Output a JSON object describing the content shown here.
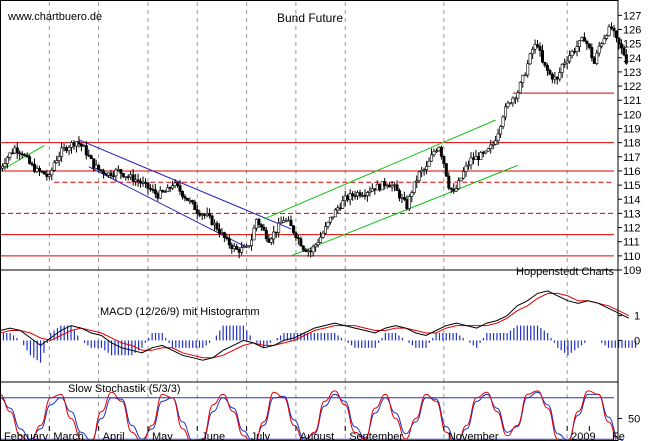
{
  "watermark": "www.chartbuero.de",
  "credit": "Hoppenstedt Charts",
  "colors": {
    "background": "#ffffff",
    "grid": "#9a9a9a",
    "price": "#000000",
    "support": "#e00000",
    "downtrend": "#2020c0",
    "uptrend": "#10c010",
    "macd": "#000000",
    "signal": "#e00000",
    "histogram": "#2030c8",
    "stoch_k": "#e00000",
    "stoch_d": "#2030c8",
    "band": "#2030c8"
  },
  "chart_data": [
    {
      "type": "candlestick",
      "title": "Bund Future",
      "y_ticks": [
        109,
        110,
        111,
        112,
        113,
        114,
        115,
        116,
        117,
        118,
        119,
        120,
        121,
        122,
        123,
        124,
        125,
        126,
        127
      ],
      "ylim": [
        109,
        127.8
      ],
      "x_range_months": [
        0,
        12.45
      ],
      "x_month_labels": [
        {
          "label": "February",
          "m": 0.5
        },
        {
          "label": "March",
          "m": 1.5
        },
        {
          "label": "April",
          "m": 2.5
        },
        {
          "label": "May",
          "m": 3.5
        },
        {
          "label": "June",
          "m": 4.5
        },
        {
          "label": "July",
          "m": 5.5
        },
        {
          "label": "August",
          "m": 6.5
        },
        {
          "label": "September",
          "m": 7.5
        },
        {
          "label": "November",
          "m": 9.5
        },
        {
          "label": "2009",
          "m": 12.0
        },
        {
          "label": "Fe",
          "m": 12.45
        }
      ],
      "price_path": [
        [
          0,
          116.2
        ],
        [
          0.15,
          117.0
        ],
        [
          0.3,
          117.6
        ],
        [
          0.45,
          117.3
        ],
        [
          0.6,
          116.5
        ],
        [
          0.75,
          116.0
        ],
        [
          0.9,
          115.8
        ],
        [
          1.0,
          115.5
        ],
        [
          1.1,
          116.6
        ],
        [
          1.25,
          117.4
        ],
        [
          1.4,
          117.8
        ],
        [
          1.55,
          118.1
        ],
        [
          1.7,
          117.6
        ],
        [
          1.8,
          117.0
        ],
        [
          1.9,
          116.4
        ],
        [
          2.0,
          116.1
        ],
        [
          2.2,
          115.8
        ],
        [
          2.4,
          116.0
        ],
        [
          2.6,
          115.6
        ],
        [
          2.8,
          115.3
        ],
        [
          3.0,
          114.8
        ],
        [
          3.2,
          114.3
        ],
        [
          3.4,
          114.6
        ],
        [
          3.5,
          115.1
        ],
        [
          3.6,
          114.8
        ],
        [
          3.8,
          114.0
        ],
        [
          4.0,
          113.2
        ],
        [
          4.2,
          112.8
        ],
        [
          4.4,
          112.0
        ],
        [
          4.6,
          111.0
        ],
        [
          4.8,
          110.4
        ],
        [
          5.0,
          110.5
        ],
        [
          5.1,
          111.2
        ],
        [
          5.2,
          112.6
        ],
        [
          5.3,
          112.0
        ],
        [
          5.45,
          111.2
        ],
        [
          5.6,
          111.8
        ],
        [
          5.75,
          112.6
        ],
        [
          5.85,
          112.3
        ],
        [
          6.0,
          111.5
        ],
        [
          6.15,
          110.6
        ],
        [
          6.3,
          110.3
        ],
        [
          6.4,
          110.8
        ],
        [
          6.55,
          111.6
        ],
        [
          6.7,
          112.6
        ],
        [
          6.85,
          113.4
        ],
        [
          7.0,
          114.0
        ],
        [
          7.2,
          114.4
        ],
        [
          7.4,
          114.5
        ],
        [
          7.55,
          114.8
        ],
        [
          7.7,
          114.9
        ],
        [
          7.85,
          115.2
        ],
        [
          8.0,
          114.8
        ],
        [
          8.15,
          114.0
        ],
        [
          8.25,
          113.5
        ],
        [
          8.35,
          114.6
        ],
        [
          8.5,
          115.8
        ],
        [
          8.65,
          116.2
        ],
        [
          8.8,
          117.4
        ],
        [
          8.9,
          117.8
        ],
        [
          9.0,
          116.6
        ],
        [
          9.1,
          115.0
        ],
        [
          9.2,
          114.4
        ],
        [
          9.3,
          115.1
        ],
        [
          9.4,
          115.9
        ],
        [
          9.55,
          116.8
        ],
        [
          9.7,
          117.0
        ],
        [
          9.85,
          117.2
        ],
        [
          10.0,
          117.9
        ],
        [
          10.1,
          118.8
        ],
        [
          10.2,
          120.0
        ],
        [
          10.35,
          121.0
        ],
        [
          10.5,
          121.6
        ],
        [
          10.65,
          123.0
        ],
        [
          10.8,
          124.6
        ],
        [
          10.9,
          125.0
        ],
        [
          11.0,
          123.6
        ],
        [
          11.15,
          122.8
        ],
        [
          11.3,
          122.4
        ],
        [
          11.4,
          123.5
        ],
        [
          11.55,
          124.2
        ],
        [
          11.7,
          124.8
        ],
        [
          11.85,
          125.4
        ],
        [
          11.95,
          124.6
        ],
        [
          12.05,
          123.6
        ],
        [
          12.15,
          124.8
        ],
        [
          12.3,
          125.8
        ],
        [
          12.4,
          126.1
        ],
        [
          12.5,
          125.2
        ],
        [
          12.65,
          124.3
        ],
        [
          12.75,
          123.3
        ]
      ],
      "horizontal_lines": [
        {
          "y": 121.5,
          "x_from_m": 10.4,
          "style": "solid"
        },
        {
          "y": 118.0,
          "x_from_m": 0,
          "style": "solid"
        },
        {
          "y": 116.0,
          "x_from_m": 0,
          "style": "solid"
        },
        {
          "y": 115.2,
          "x_from_m": 1.1,
          "style": "dashed"
        },
        {
          "y": 113.0,
          "x_from_m": 0,
          "style": "dashed"
        },
        {
          "y": 111.5,
          "x_from_m": 0,
          "style": "solid"
        },
        {
          "y": 110.0,
          "x_from_m": 0,
          "style": "solid"
        }
      ],
      "trend_lines": [
        {
          "name": "down-upper",
          "color": "downtrend",
          "from": [
            1.6,
            118.2
          ],
          "to": [
            5.9,
            111.9
          ]
        },
        {
          "name": "down-lower",
          "color": "downtrend",
          "from": [
            1.8,
            116.3
          ],
          "to": [
            5.0,
            110.6
          ]
        },
        {
          "name": "up-upper",
          "color": "uptrend",
          "from": [
            5.35,
            112.6
          ],
          "to": [
            10.05,
            119.6
          ]
        },
        {
          "name": "up-lower",
          "color": "uptrend",
          "from": [
            5.9,
            110.0
          ],
          "to": [
            10.5,
            116.4
          ]
        },
        {
          "name": "early-up",
          "color": "uptrend",
          "from": [
            0.1,
            116.2
          ],
          "to": [
            0.9,
            117.8
          ]
        }
      ]
    },
    {
      "type": "line",
      "title": "MACD (12/26/9) mit Histogramm",
      "y_ticks": [
        1,
        0
      ],
      "ylim": [
        -1.6,
        2.2
      ],
      "series": [
        {
          "key": "macd",
          "values": [
            0.4,
            0.5,
            0.4,
            0.1,
            -0.2,
            0.1,
            0.4,
            0.6,
            0.5,
            0.3,
            0.2,
            -0.1,
            -0.3,
            -0.4,
            -0.5,
            -0.3,
            -0.2,
            -0.4,
            -0.6,
            -0.7,
            -0.8,
            -0.7,
            -0.4,
            -0.2,
            0.0,
            -0.1,
            -0.3,
            -0.2,
            0.0,
            0.1,
            0.3,
            0.5,
            0.6,
            0.7,
            0.6,
            0.5,
            0.4,
            0.3,
            0.5,
            0.6,
            0.5,
            0.3,
            0.2,
            0.4,
            0.6,
            0.7,
            0.6,
            0.5,
            0.7,
            0.8,
            1.0,
            1.4,
            1.6,
            1.9,
            2.0,
            1.8,
            1.6,
            1.5,
            1.6,
            1.5,
            1.3,
            1.1,
            0.9
          ]
        },
        {
          "key": "signal",
          "values": [
            0.3,
            0.4,
            0.4,
            0.3,
            0.1,
            0.0,
            0.2,
            0.4,
            0.5,
            0.4,
            0.3,
            0.1,
            -0.1,
            -0.2,
            -0.4,
            -0.4,
            -0.3,
            -0.3,
            -0.5,
            -0.6,
            -0.7,
            -0.7,
            -0.6,
            -0.4,
            -0.2,
            -0.1,
            -0.2,
            -0.2,
            -0.1,
            0.0,
            0.2,
            0.4,
            0.5,
            0.6,
            0.6,
            0.6,
            0.5,
            0.4,
            0.4,
            0.5,
            0.5,
            0.4,
            0.3,
            0.3,
            0.5,
            0.6,
            0.6,
            0.6,
            0.6,
            0.7,
            0.9,
            1.2,
            1.4,
            1.7,
            1.9,
            1.9,
            1.8,
            1.6,
            1.6,
            1.5,
            1.4,
            1.2,
            1.0
          ]
        }
      ]
    },
    {
      "type": "line",
      "title": "Slow Stochastik (5/3/3)",
      "y_ticks": [
        50
      ],
      "ylim": [
        0,
        100
      ],
      "bands": [
        80,
        20
      ],
      "series": [
        {
          "key": "stoch_k",
          "values": [
            85,
            60,
            25,
            15,
            40,
            80,
            85,
            50,
            20,
            15,
            60,
            88,
            75,
            30,
            15,
            40,
            85,
            80,
            35,
            12,
            20,
            70,
            85,
            60,
            25,
            10,
            45,
            88,
            80,
            40,
            15,
            30,
            75,
            90,
            70,
            30,
            20,
            65,
            85,
            50,
            20,
            50,
            85,
            75,
            30,
            10,
            40,
            80,
            88,
            60,
            25,
            40,
            85,
            90,
            65,
            20,
            15,
            60,
            90,
            85,
            45,
            15,
            10
          ]
        },
        {
          "key": "stoch_d",
          "values": [
            80,
            65,
            35,
            20,
            35,
            70,
            80,
            60,
            30,
            18,
            50,
            80,
            78,
            40,
            20,
            35,
            75,
            80,
            45,
            18,
            20,
            60,
            80,
            65,
            32,
            15,
            40,
            80,
            82,
            48,
            20,
            28,
            68,
            85,
            75,
            38,
            22,
            58,
            80,
            58,
            28,
            45,
            80,
            78,
            38,
            15,
            35,
            75,
            85,
            65,
            30,
            38,
            80,
            88,
            70,
            28,
            18,
            55,
            85,
            85,
            52,
            20,
            12
          ]
        }
      ]
    }
  ]
}
